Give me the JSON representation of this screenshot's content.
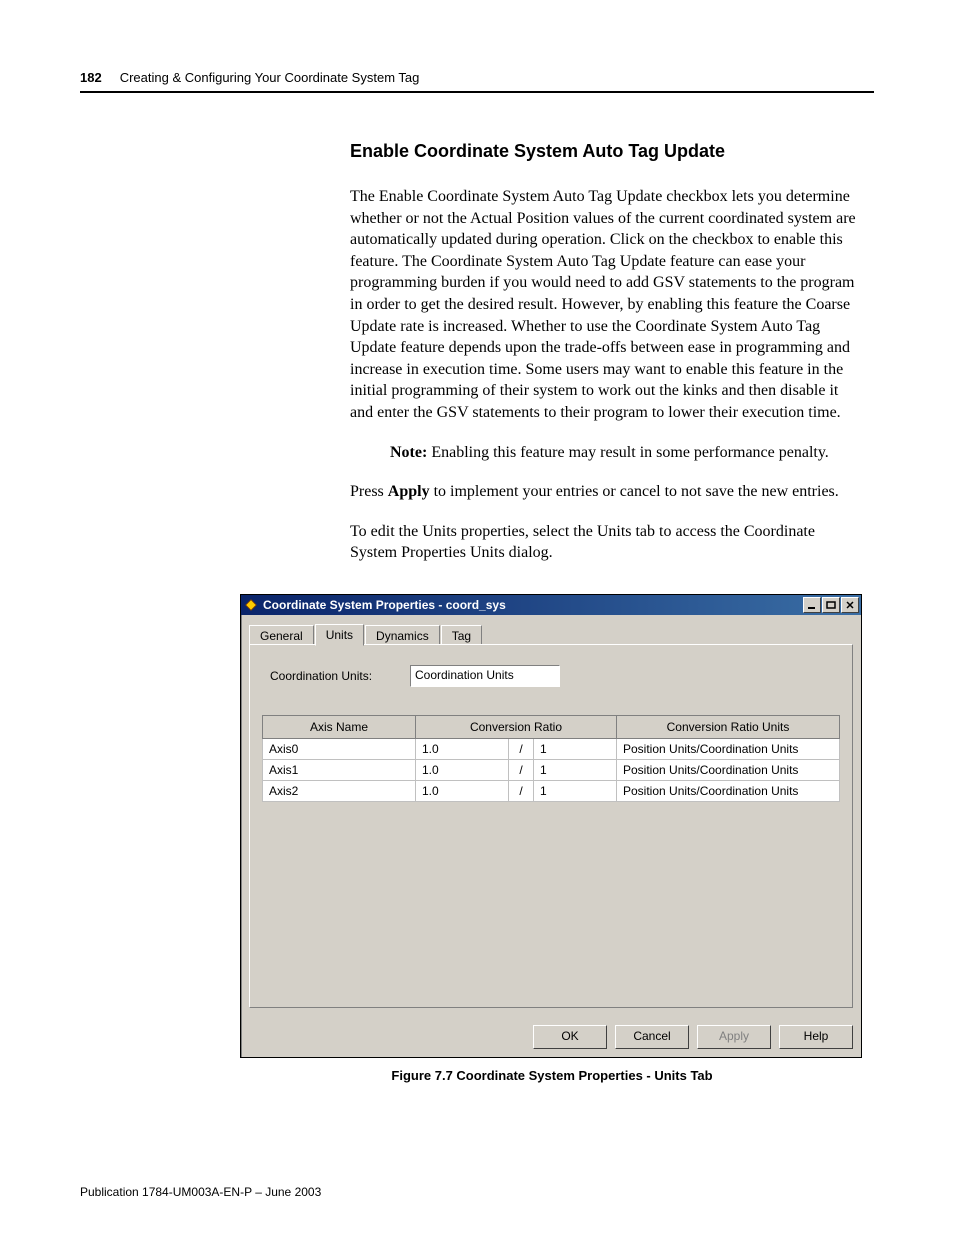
{
  "header": {
    "page_number": "182",
    "chapter": "Creating & Configuring Your Coordinate System Tag"
  },
  "section": {
    "heading": "Enable Coordinate System Auto Tag Update",
    "para1": "The Enable Coordinate System Auto Tag Update checkbox lets you determine whether or not the Actual Position values of the current coordinated system are automatically updated during operation. Click on the checkbox to enable this feature. The Coordinate System Auto Tag Update feature can ease your programming burden if you would need to add GSV statements to the program in order to get the desired result. However, by enabling this feature the Coarse Update rate is increased. Whether to use the Coordinate System Auto Tag Update feature depends upon the trade-offs between ease in programming and increase in execution time. Some users may want to enable this feature in the initial programming of their system to work out the kinks and then disable it and enter the GSV statements to their program to lower their execution time.",
    "note_label": "Note:",
    "note_text": " Enabling this feature may result in some performance penalty.",
    "para2_pre": "Press ",
    "para2_bold": "Apply",
    "para2_post": " to implement your entries or cancel to not save the new entries.",
    "para3": "To edit the Units properties, select the Units tab to access the Coordinate System Properties Units dialog."
  },
  "dialog": {
    "title": "Coordinate System Properties - coord_sys",
    "tabs": [
      "General",
      "Units",
      "Dynamics",
      "Tag"
    ],
    "active_tab": "Units",
    "coord_units_label": "Coordination Units:",
    "coord_units_value": "Coordination Units",
    "columns": {
      "axis_name": "Axis Name",
      "conversion_ratio": "Conversion Ratio",
      "conversion_ratio_units": "Conversion Ratio Units"
    },
    "rows": [
      {
        "name": "Axis0",
        "num": "1.0",
        "sep": "/",
        "den": "1",
        "units": "Position Units/Coordination Units"
      },
      {
        "name": "Axis1",
        "num": "1.0",
        "sep": "/",
        "den": "1",
        "units": "Position Units/Coordination Units"
      },
      {
        "name": "Axis2",
        "num": "1.0",
        "sep": "/",
        "den": "1",
        "units": "Position Units/Coordination Units"
      }
    ],
    "buttons": {
      "ok": "OK",
      "cancel": "Cancel",
      "apply": "Apply",
      "help": "Help"
    }
  },
  "figure_caption": "Figure 7.7 Coordinate System Properties - Units Tab",
  "footer": "Publication 1784-UM003A-EN-P – June 2003"
}
